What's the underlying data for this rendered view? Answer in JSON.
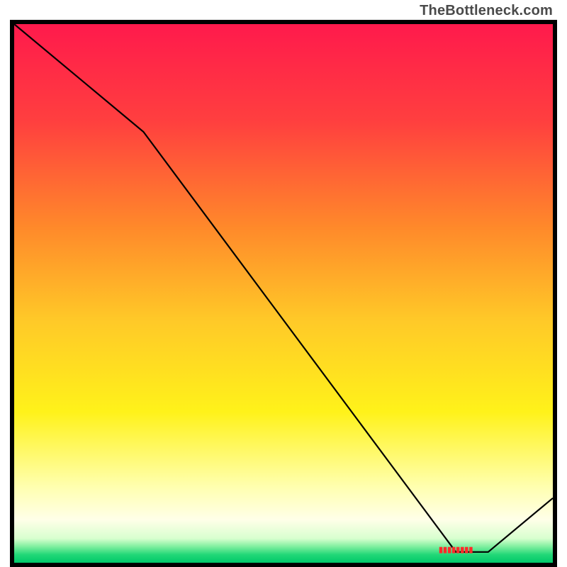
{
  "attribution": "TheBottleneck.com",
  "chart_data": {
    "type": "line",
    "title": "",
    "xlabel": "",
    "ylabel": "",
    "x": [
      0.0,
      0.24,
      0.82,
      0.88,
      1.0
    ],
    "y": [
      1.0,
      0.8,
      0.02,
      0.02,
      0.12
    ],
    "xlim": [
      0,
      1
    ],
    "ylim": [
      0,
      1
    ],
    "annotations": [
      {
        "text": "(illegible label)",
        "x": 0.82,
        "y": 0.025,
        "color": "#ff2a2a"
      }
    ],
    "background_gradient": {
      "stops": [
        {
          "offset": 0.0,
          "color": "#ff1a4c"
        },
        {
          "offset": 0.18,
          "color": "#ff3f3f"
        },
        {
          "offset": 0.38,
          "color": "#ff8a2a"
        },
        {
          "offset": 0.55,
          "color": "#ffc928"
        },
        {
          "offset": 0.72,
          "color": "#fff21a"
        },
        {
          "offset": 0.86,
          "color": "#ffffb0"
        },
        {
          "offset": 0.92,
          "color": "#ffffe8"
        },
        {
          "offset": 0.955,
          "color": "#d8ffcf"
        },
        {
          "offset": 0.97,
          "color": "#7fef9f"
        },
        {
          "offset": 0.985,
          "color": "#22d877"
        },
        {
          "offset": 1.0,
          "color": "#00c86a"
        }
      ]
    }
  }
}
